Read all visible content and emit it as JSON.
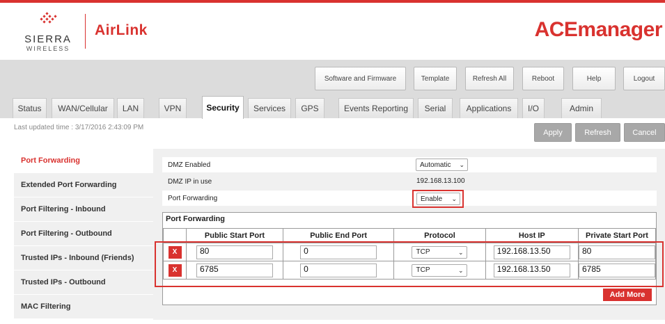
{
  "brand": {
    "sierra": "SIERRA",
    "wireless": "WIRELESS",
    "airlink": "AirLink",
    "app_title": "ACEmanager",
    "accent_color": "#d9322f"
  },
  "top_buttons": [
    "Software and Firmware",
    "Template",
    "Refresh All",
    "Reboot",
    "Help",
    "Logout"
  ],
  "tabs": [
    "Status",
    "WAN/Cellular",
    "LAN",
    "VPN",
    "Security",
    "Services",
    "GPS",
    "Events Reporting",
    "Serial",
    "Applications",
    "I/O",
    "Admin"
  ],
  "active_tab": "Security",
  "last_updated": "Last updated time : 3/17/2016 2:43:09 PM",
  "actions": {
    "apply": "Apply",
    "refresh": "Refresh",
    "cancel": "Cancel"
  },
  "sidebar": {
    "items": [
      "Port Forwarding",
      "Extended Port Forwarding",
      "Port Filtering - Inbound",
      "Port Filtering - Outbound",
      "Trusted IPs - Inbound (Friends)",
      "Trusted IPs - Outbound",
      "MAC Filtering"
    ],
    "active": "Port Forwarding"
  },
  "settings": {
    "dmz_enabled": {
      "label": "DMZ Enabled",
      "value": "Automatic"
    },
    "dmz_ip": {
      "label": "DMZ IP in use",
      "value": "192.168.13.100"
    },
    "port_forwarding": {
      "label": "Port Forwarding",
      "value": "Enable"
    }
  },
  "pf_table": {
    "title": "Port Forwarding",
    "columns": [
      "Public Start Port",
      "Public End Port",
      "Protocol",
      "Host IP",
      "Private Start Port"
    ],
    "rows": [
      {
        "delete": "X",
        "public_start": "80",
        "public_end": "0",
        "protocol": "TCP",
        "host_ip": "192.168.13.50",
        "private_start": "80"
      },
      {
        "delete": "X",
        "public_start": "6785",
        "public_end": "0",
        "protocol": "TCP",
        "host_ip": "192.168.13.50",
        "private_start": "6785"
      }
    ],
    "add_more": "Add More"
  },
  "icons": {
    "logo": "sierra-logo-icon",
    "dropdown": "chevron-down-icon"
  }
}
